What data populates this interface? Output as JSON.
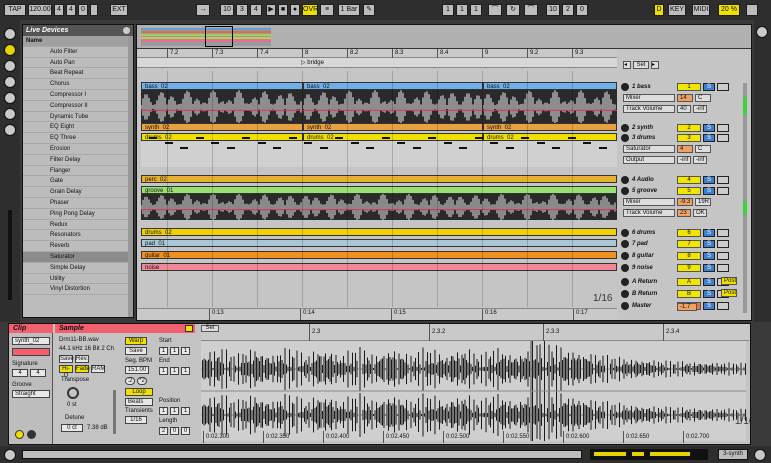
{
  "transport": {
    "tap": "TAP",
    "tempo": "120.00",
    "sig_num": "4",
    "sig_den": "4",
    "metro": "0",
    "ext": "EXT",
    "bar": "10",
    "beat": "3",
    "sixteenth": "4",
    "ovr": "OVR",
    "quant": "1 Bar",
    "loop_start": [
      "1",
      "1",
      "1"
    ],
    "loop_len": [
      "10",
      "2",
      "0"
    ],
    "key": "KEY",
    "midi": "MIDI",
    "cpu": "20 %",
    "d_label": "D"
  },
  "browser": {
    "title": "Live Devices",
    "items": [
      "Name",
      "Auto Filter",
      "Auto Pan",
      "Beat Repeat",
      "Chorus",
      "Compressor I",
      "Compressor II",
      "Dynamic Tube",
      "EQ Eight",
      "EQ Three",
      "Erosion",
      "Filter Delay",
      "Flanger",
      "Gate",
      "Grain Delay",
      "Phaser",
      "Ping Pong Delay",
      "Redux",
      "Resonators",
      "Reverb",
      "Saturator",
      "Simple Delay",
      "Utility",
      "Vinyl Distortion"
    ],
    "selected": "Saturator"
  },
  "arrangement": {
    "ruler": [
      "7.2",
      "7.3",
      "7.4",
      "8",
      "8.2",
      "8.3",
      "8.4",
      "9",
      "9.2",
      "9.3"
    ],
    "locator": "bridge",
    "set_label": "Set",
    "time_ruler": [
      "0:13",
      "0:14",
      "0:15",
      "0:16",
      "0:17"
    ],
    "zoom": "1/16",
    "lanes": {
      "bass_clip": "bass_02",
      "synth_clip": "synth_02",
      "drums_clip": "drums_02",
      "perc_clip": "perc_02",
      "groove_clip": "groove_01",
      "drums6_clip": "drums_02",
      "pad_clip": "pad_01",
      "guitar_clip": "guitar_01",
      "noise_clip": "noise"
    }
  },
  "tracks": [
    {
      "name": "1 bass",
      "num": "1",
      "color": "#f2e500"
    },
    {
      "name": "2 synth",
      "num": "2",
      "color": "#f2e500"
    },
    {
      "name": "3 drums",
      "num": "3",
      "color": "#f2e500"
    },
    {
      "name": "4 Audio",
      "num": "4",
      "color": "#f2e500"
    },
    {
      "name": "5 groove",
      "num": "5",
      "color": "#f2e500"
    },
    {
      "name": "6 drums",
      "num": "6",
      "color": "#f2e500"
    },
    {
      "name": "7 pad",
      "num": "7",
      "color": "#f2e500"
    },
    {
      "name": "8 guitar",
      "num": "8",
      "color": "#f2e500"
    },
    {
      "name": "9 noise",
      "num": "9",
      "color": "#f2e500"
    },
    {
      "name": "A Return",
      "num": "A",
      "color": "#f2e500"
    },
    {
      "name": "B Return",
      "num": "B",
      "color": "#f2e500"
    },
    {
      "name": "Master",
      "num": "",
      "color": "#f2e500"
    }
  ],
  "track_params": {
    "bass_dev": "Mixer",
    "bass_param": "Track Volume",
    "bass_val1": "14",
    "bass_val2": "C",
    "bass_val3": "40",
    "bass_val4": "-inf",
    "drums_dev": "Saturator",
    "drums_param": "Output",
    "drums_val1": "4",
    "drums_val2": "C",
    "drums_val3": "-inf",
    "drums_val4": "-inf",
    "groove_dev": "Mixer",
    "groove_param": "Track Volume",
    "groove_val1": "-9.3",
    "groove_val2": "19R",
    "groove_val3": "23",
    "groove_val4": "OK",
    "post_a": "Post",
    "post_b": "Post",
    "master_val": "-1.7",
    "solo": "S"
  },
  "clip_view": {
    "clip_title": "Clip",
    "clip_name": "synth_02",
    "signature_label": "Signature",
    "sig_num": "4",
    "sig_den": "4",
    "groove_label": "Groove",
    "groove_val": "Straight",
    "sample_title": "Sample",
    "file": "Drm11-BB.wav",
    "format": "44.1 kHz 16 Bit 2 Ch",
    "save": "Save",
    "rev": "Rev.",
    "hiq": "Hi-Q",
    "fade": "Fade",
    "ram": "RAM",
    "transpose_label": "Transpose",
    "transpose_val": "0 st",
    "detune_label": "Detune",
    "detune_val": "0 ct",
    "gain_val": "7.38 dB",
    "warp": "Warp",
    "save2": "Save",
    "seg_bpm_label": "Seg. BPM",
    "seg_bpm": "151.00",
    "half": ":2",
    "double": "*2",
    "loop": "Loop",
    "mode": "Beats",
    "transients_label": "Transients",
    "transients": "1/16",
    "start_label": "Start",
    "start_vals": [
      "1",
      "1",
      "1"
    ],
    "end_label": "End",
    "end_vals": [
      "1",
      "1",
      "1"
    ],
    "position_label": "Position",
    "position_vals": [
      "1",
      "1",
      "1"
    ],
    "length_label": "Length",
    "length_vals": [
      "2",
      "0",
      "0"
    ],
    "set_label": "Set",
    "wave_ruler": [
      "2.3",
      "2.3.2",
      "2.3.3",
      "2.3.4"
    ],
    "wave_time": [
      "0:02.300",
      "0:02.350",
      "0:02.400",
      "0:02.450",
      "0:02.500",
      "0:02.550",
      "0:02.600",
      "0:02.650",
      "0:02.700"
    ],
    "zoom": "1/16"
  },
  "status": {
    "track_label": "3-synth"
  }
}
